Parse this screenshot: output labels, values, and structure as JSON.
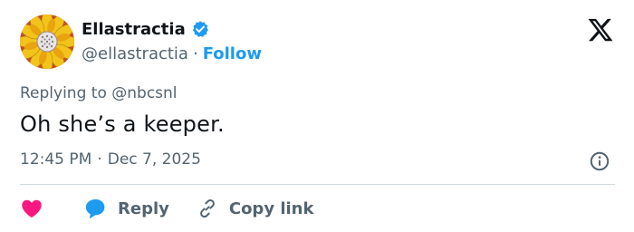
{
  "author": {
    "display_name": "Ellastractia",
    "handle": "@ellastractia",
    "separator": "·",
    "follow_label": "Follow"
  },
  "replying": {
    "prefix": "Replying to ",
    "handle": "@nbcsnl"
  },
  "tweet": {
    "text": "Oh she’s a keeper."
  },
  "meta": {
    "time": "12:45 PM",
    "separator": "·",
    "date": "Dec 7, 2025"
  },
  "actions": {
    "reply_label": "Reply",
    "copy_link_label": "Copy link"
  },
  "colors": {
    "accent": "#1d9bf0",
    "heart": "#f91880",
    "muted_text": "#536471",
    "divider": "#cfd9de"
  },
  "icons": {
    "verified": "verified-badge-icon",
    "brand": "x-logo-icon",
    "info": "info-icon",
    "like": "heart-icon",
    "reply": "speech-bubble-icon",
    "copy": "link-icon"
  }
}
